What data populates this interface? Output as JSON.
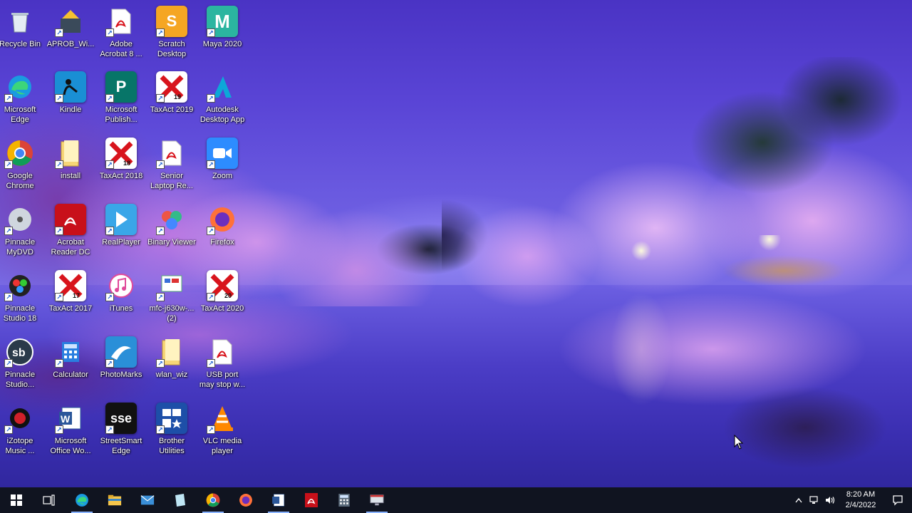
{
  "desktop": {
    "icons": [
      {
        "label": "Recycle Bin",
        "icon": "recycle-bin-icon",
        "color": "#c8d4e0"
      },
      {
        "label": "APROB_Wi...",
        "icon": "installer-icon",
        "color": "#e8b030"
      },
      {
        "label": "Adobe\nAcrobat 8 ...",
        "icon": "acrobat-icon",
        "color": "#ffffff"
      },
      {
        "label": "Scratch\nDesktop",
        "icon": "scratch-icon",
        "color": "#f5a623"
      },
      {
        "label": "Maya 2020",
        "icon": "maya-icon",
        "color": "#2bb5a0"
      },
      {
        "label": "Microsoft\nEdge",
        "icon": "edge-icon",
        "color": "#1e88e5"
      },
      {
        "label": "Kindle",
        "icon": "kindle-icon",
        "color": "#1a8fd4"
      },
      {
        "label": "Microsoft\nPublish...",
        "icon": "publisher-icon",
        "color": "#077568"
      },
      {
        "label": "TaxAct 2019",
        "icon": "taxact-icon",
        "color": "#ffffff",
        "badge": "19"
      },
      {
        "label": "Autodesk\nDesktop App",
        "icon": "autodesk-icon",
        "color": "#0696d7"
      },
      {
        "label": "Google\nChrome",
        "icon": "chrome-icon",
        "color": "#ffffff"
      },
      {
        "label": "install",
        "icon": "folder-icon",
        "color": "#f5d36b"
      },
      {
        "label": "TaxAct 2018",
        "icon": "taxact-icon",
        "color": "#ffffff",
        "badge": "18"
      },
      {
        "label": "Senior\nLaptop Re...",
        "icon": "pdf-icon",
        "color": "#ffffff"
      },
      {
        "label": "Zoom",
        "icon": "zoom-icon",
        "color": "#2d8cff"
      },
      {
        "label": "Pinnacle\nMyDVD",
        "icon": "mydvd-icon",
        "color": "#9aa0a8"
      },
      {
        "label": "Acrobat\nReader DC",
        "icon": "acrobat-reader-icon",
        "color": "#c8101a"
      },
      {
        "label": "RealPlayer",
        "icon": "realplayer-icon",
        "color": "#3aa6e8"
      },
      {
        "label": "Binary Viewer",
        "icon": "binary-viewer-icon",
        "color": "#5cb85c"
      },
      {
        "label": "Firefox",
        "icon": "firefox-icon",
        "color": "#ff7139"
      },
      {
        "label": "Pinnacle\nStudio 18",
        "icon": "pinnacle-studio-icon",
        "color": "#333333"
      },
      {
        "label": "TaxAct 2017",
        "icon": "taxact-icon",
        "color": "#ffffff",
        "badge": "17"
      },
      {
        "label": "iTunes",
        "icon": "itunes-icon",
        "color": "#ffffff"
      },
      {
        "label": "mfc-j630w-...\n(2)",
        "icon": "printer-software-icon",
        "color": "#dfe6ee"
      },
      {
        "label": "TaxAct 2020",
        "icon": "taxact-icon",
        "color": "#ffffff",
        "badge": "20"
      },
      {
        "label": "Pinnacle\nStudio...",
        "icon": "pinnacle-sb-icon",
        "color": "#2a3a4a"
      },
      {
        "label": "Calculator",
        "icon": "calculator-icon",
        "color": "#1f6fd0"
      },
      {
        "label": "PhotoMarks",
        "icon": "photomarks-icon",
        "color": "#2a8fd8"
      },
      {
        "label": "wlan_wiz",
        "icon": "folder-icon",
        "color": "#f5d36b"
      },
      {
        "label": "USB port\nmay stop w...",
        "icon": "pdf-icon",
        "color": "#ffffff"
      },
      {
        "label": "iZotope\nMusic ...",
        "icon": "izotope-icon",
        "color": "#d0202a"
      },
      {
        "label": "Microsoft\nOffice Wo...",
        "icon": "word-icon",
        "color": "#ffffff"
      },
      {
        "label": "StreetSmart\nEdge",
        "icon": "streetsmart-icon",
        "color": "#111111"
      },
      {
        "label": "Brother\nUtilities",
        "icon": "brother-utilities-icon",
        "color": "#1d4fa8"
      },
      {
        "label": "VLC media\nplayer",
        "icon": "vlc-icon",
        "color": "#ff8800"
      }
    ]
  },
  "taskbar": {
    "buttons": [
      {
        "name": "start-button",
        "icon": "windows-logo-icon",
        "running": false
      },
      {
        "name": "task-view-button",
        "icon": "task-view-icon",
        "running": false
      },
      {
        "name": "taskbar-edge",
        "icon": "edge-icon",
        "running": true
      },
      {
        "name": "taskbar-file-explorer",
        "icon": "file-explorer-icon",
        "running": false
      },
      {
        "name": "taskbar-mail",
        "icon": "mail-icon",
        "running": false
      },
      {
        "name": "taskbar-notes",
        "icon": "notes-icon",
        "running": false
      },
      {
        "name": "taskbar-chrome",
        "icon": "chrome-icon",
        "running": true
      },
      {
        "name": "taskbar-firefox",
        "icon": "firefox-icon",
        "running": false
      },
      {
        "name": "taskbar-word",
        "icon": "word-icon",
        "running": true
      },
      {
        "name": "taskbar-acrobat",
        "icon": "acrobat-icon",
        "running": false
      },
      {
        "name": "taskbar-calculator",
        "icon": "calculator-icon",
        "running": false
      },
      {
        "name": "taskbar-screen",
        "icon": "screen-icon",
        "running": true
      }
    ],
    "tray": {
      "time": "8:20 AM",
      "date": "2/4/2022"
    }
  }
}
